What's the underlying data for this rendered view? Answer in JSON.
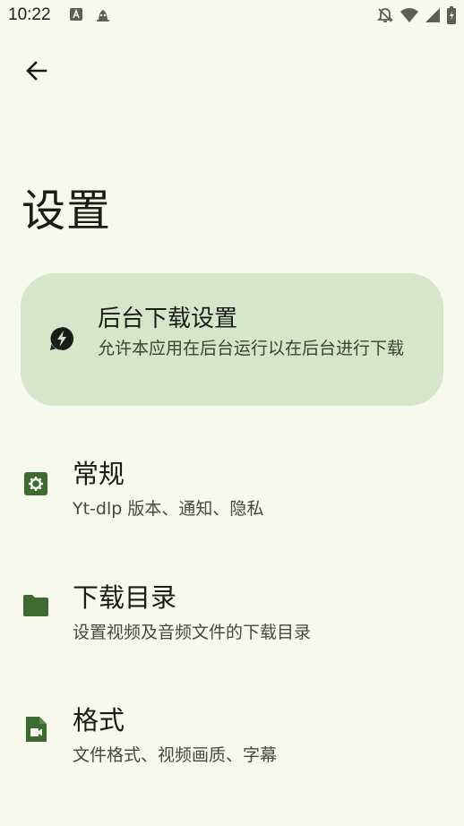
{
  "status_bar": {
    "time": "10:22",
    "left_icons": [
      "font-notification-icon",
      "app-notification-icon"
    ],
    "right_icons": [
      "do-not-disturb-icon",
      "wifi-icon",
      "signal-icon",
      "battery-icon"
    ]
  },
  "header": {
    "back_icon": "arrow-back-icon",
    "title": "设置"
  },
  "background_card": {
    "icon": "bolt-icon",
    "title": "后台下载设置",
    "description": "允许本应用在后台运行以在后台进行下载"
  },
  "settings": [
    {
      "icon": "gear-icon",
      "title": "常规",
      "description": "Yt-dlp 版本、通知、隐私"
    },
    {
      "icon": "folder-icon",
      "title": "下载目录",
      "description": "设置视频及音频文件的下载目录"
    },
    {
      "icon": "video-file-icon",
      "title": "格式",
      "description": "文件格式、视频画质、字幕"
    }
  ],
  "colors": {
    "background": "#f7f9ef",
    "card_background": "#d6e7c9",
    "accent_icon": "#3d6a30",
    "text_primary": "#1b1c18"
  }
}
